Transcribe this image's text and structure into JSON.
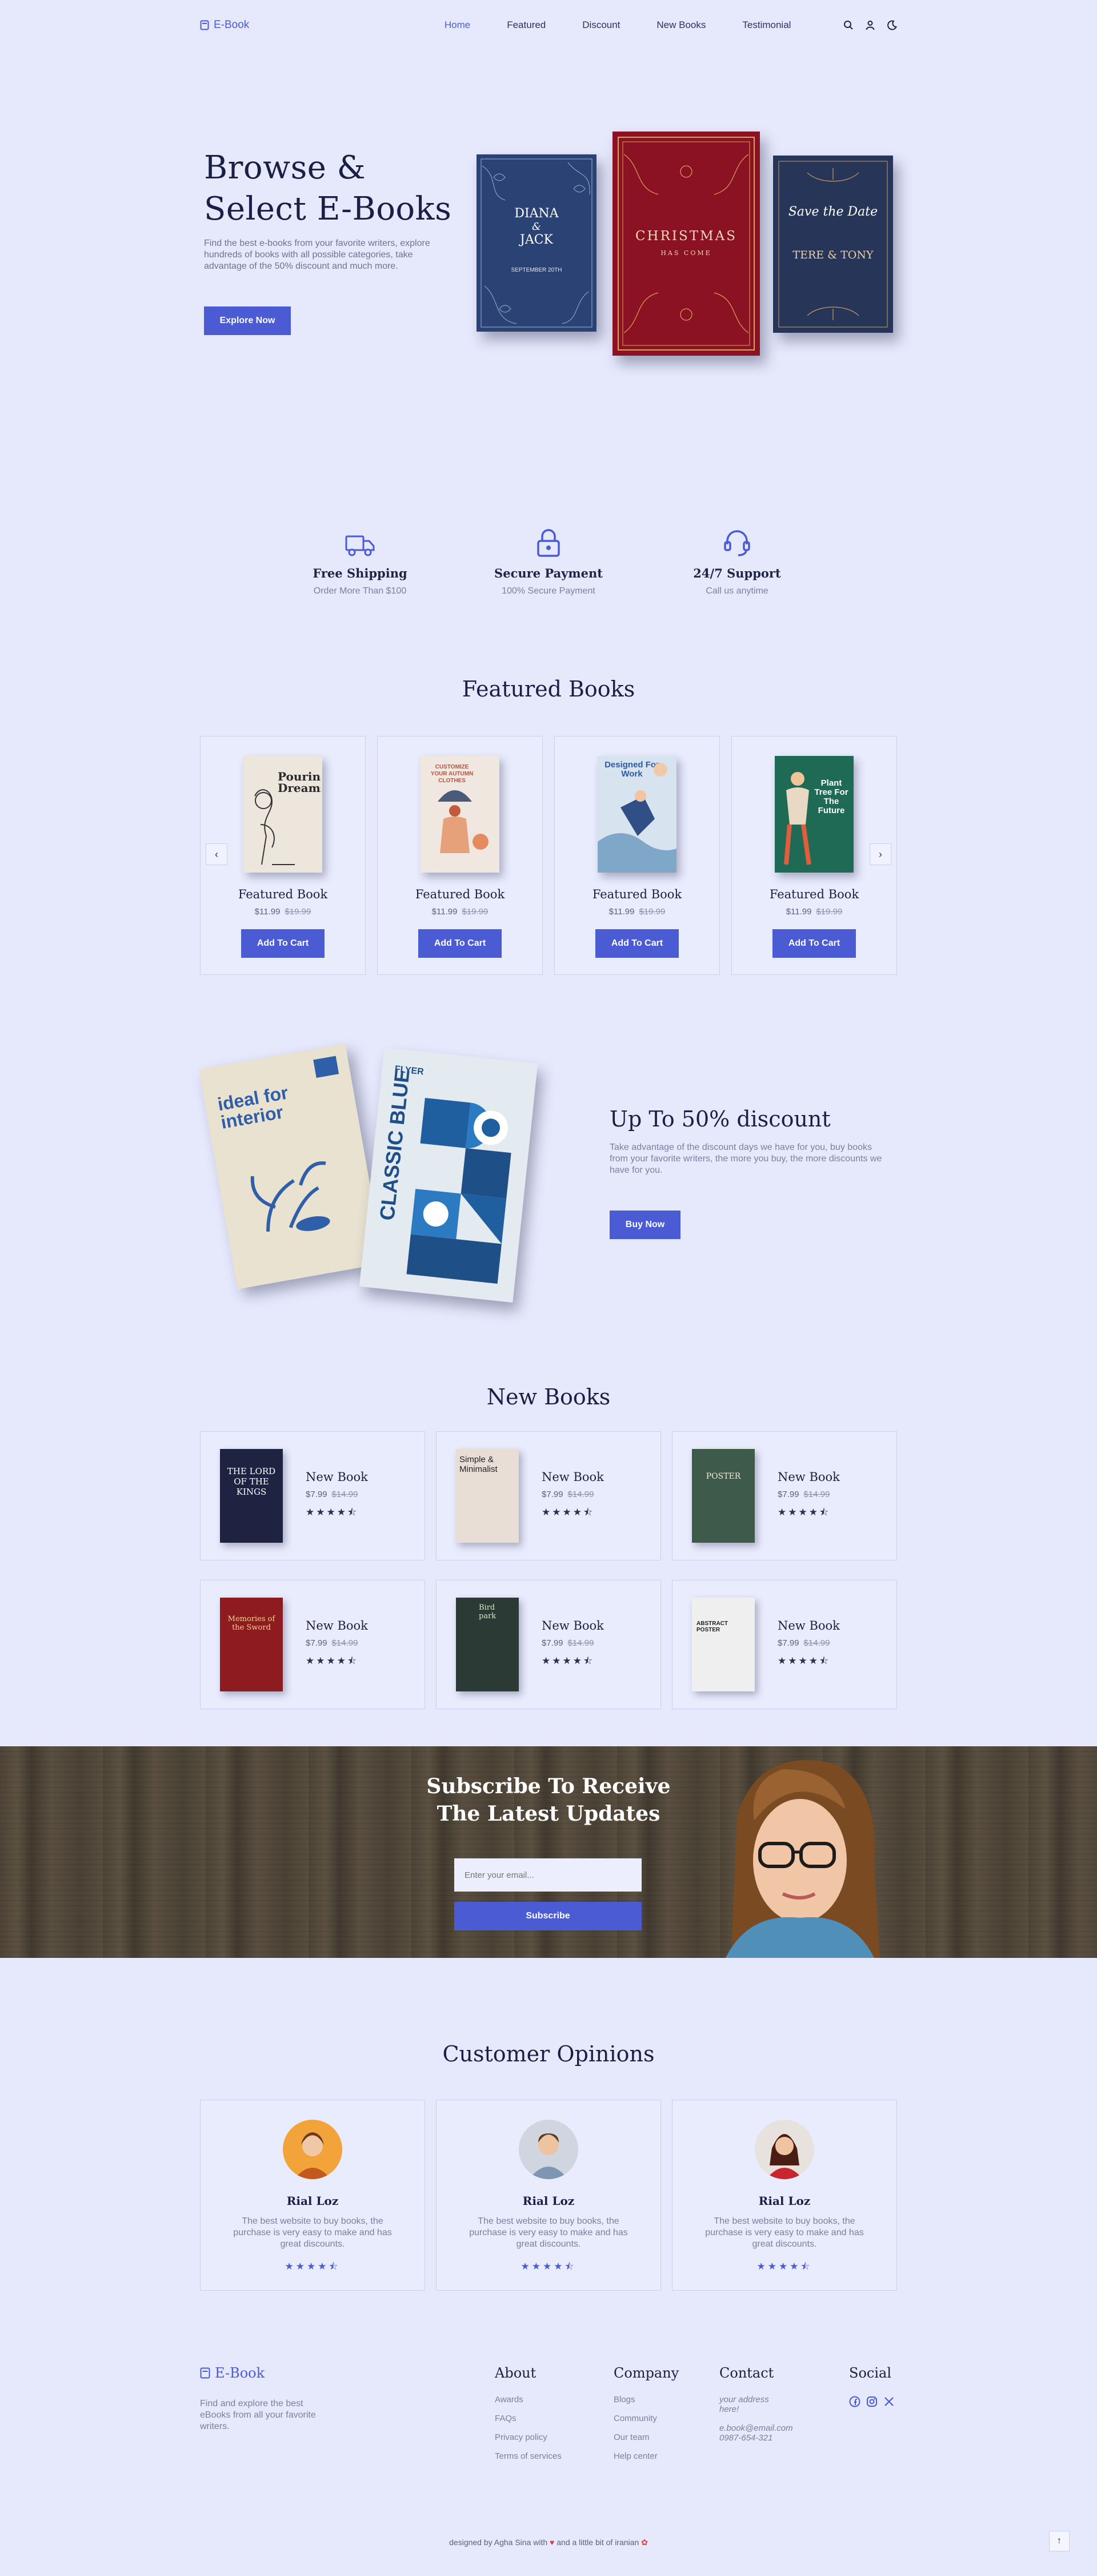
{
  "nav": {
    "logo": "E-Book",
    "links": [
      "Home",
      "Featured",
      "Discount",
      "New Books",
      "Testimonial"
    ],
    "icons": [
      "search-icon",
      "user-icon",
      "moon-icon"
    ]
  },
  "hero": {
    "title_line1": "Browse &",
    "title_line2": "Select E-Books",
    "subtitle": "Find the best e-books from your favorite writers, explore hundreds of books with all possible categories, take advantage of the 50% discount and much more.",
    "button": "Explore Now",
    "books": [
      {
        "title1": "DIANA",
        "amp": "&",
        "title2": "JACK",
        "date": "SEPTEMBER 20TH"
      },
      {
        "title1": "CHRISTMAS",
        "title2": "HAS COME"
      },
      {
        "title1": "Save the Date",
        "title2": "TERE & TONY"
      }
    ]
  },
  "features": [
    {
      "icon": "truck-icon",
      "title": "Free Shipping",
      "subtitle": "Order More Than $100"
    },
    {
      "icon": "lock-icon",
      "title": "Secure Payment",
      "subtitle": "100% Secure Payment"
    },
    {
      "icon": "headset-icon",
      "title": "24/7 Support",
      "subtitle": "Call us anytime"
    }
  ],
  "featured": {
    "heading": "Featured Books",
    "books": [
      {
        "title": "Featured Book",
        "price": "$11.99",
        "old_price": "$19.99",
        "button": "Add To Cart",
        "cover_text": "Pouring Dreams"
      },
      {
        "title": "Featured Book",
        "price": "$11.99",
        "old_price": "$19.99",
        "button": "Add To Cart",
        "cover_text": "CUSTOMIZE YOUR AUTUMN CLOTHES"
      },
      {
        "title": "Featured Book",
        "price": "$11.99",
        "old_price": "$19.99",
        "button": "Add To Cart",
        "cover_text": "Designed For Work"
      },
      {
        "title": "Featured Book",
        "price": "$11.99",
        "old_price": "$19.99",
        "button": "Add To Cart",
        "cover_text": "Plant Tree For The Future"
      }
    ],
    "prev": "‹",
    "next": "›"
  },
  "discount": {
    "title": "Up To 50% discount",
    "subtitle": "Take advantage of the discount days we have for you, buy books from your favorite writers, the more you buy, the more discounts we have for you.",
    "button": "Buy Now",
    "book1": {
      "label": "ideal for interior"
    },
    "book2": {
      "label": "CLASSIC BLUE",
      "top": "FLYER"
    }
  },
  "new_books": {
    "heading": "New Books",
    "books": [
      {
        "title": "New Book",
        "price": "$7.99",
        "old_price": "$14.99",
        "stars": "★★★★⯪",
        "cover_text": "THE LORD OF THE KINGS",
        "cover_color": "#1e2342"
      },
      {
        "title": "New Book",
        "price": "$7.99",
        "old_price": "$14.99",
        "stars": "★★★★⯪",
        "cover_text": "Simple & Minimalist",
        "cover_color": "#e8ded6"
      },
      {
        "title": "New Book",
        "price": "$7.99",
        "old_price": "$14.99",
        "stars": "★★★★⯪",
        "cover_text": "POSTER",
        "cover_color": "#3e5a4a"
      },
      {
        "title": "New Book",
        "price": "$7.99",
        "old_price": "$14.99",
        "stars": "★★★★⯪",
        "cover_text": "Memories of the Sword",
        "cover_color": "#8e1b1f"
      },
      {
        "title": "New Book",
        "price": "$7.99",
        "old_price": "$14.99",
        "stars": "★★★★⯪",
        "cover_text": "Bird park",
        "cover_color": "#2b3a35"
      },
      {
        "title": "New Book",
        "price": "$7.99",
        "old_price": "$14.99",
        "stars": "★★★★⯪",
        "cover_text": "ABSTRACT POSTER",
        "cover_color": "#efefef"
      }
    ]
  },
  "subscribe": {
    "title_line1": "Subscribe To Receive",
    "title_line2": "The Latest Updates",
    "placeholder": "Enter your email...",
    "button": "Subscribe"
  },
  "opinions": {
    "heading": "Customer Opinions",
    "items": [
      {
        "name": "Rial Loz",
        "text": "The best website to buy books, the purchase is very easy to make and has great discounts.",
        "stars": "★★★★⯪",
        "avatar_bg": "#f2a33a"
      },
      {
        "name": "Rial Loz",
        "text": "The best website to buy books, the purchase is very easy to make and has great discounts.",
        "stars": "★★★★⯪",
        "avatar_bg": "#cfd6e0"
      },
      {
        "name": "Rial Loz",
        "text": "The best website to buy books, the purchase is very easy to make and has great discounts.",
        "stars": "★★★★⯪",
        "avatar_bg": "#e7e2de"
      }
    ]
  },
  "footer": {
    "logo": "E-Book",
    "description": "Find and explore the best eBooks from all your favorite writers.",
    "about": {
      "heading": "About",
      "links": [
        "Awards",
        "FAQs",
        "Privacy policy",
        "Terms of services"
      ]
    },
    "company": {
      "heading": "Company",
      "links": [
        "Blogs",
        "Community",
        "Our team",
        "Help center"
      ]
    },
    "contact": {
      "heading": "Contact",
      "address_line1": "your address",
      "address_line2": "here!",
      "email": "e.book@email.com",
      "phone": "0987-654-321"
    },
    "social": {
      "heading": "Social",
      "icons": [
        "facebook-icon",
        "instagram-icon",
        "x-icon"
      ]
    },
    "credit_part1": "designed by Agha Sina with",
    "credit_part2": "and a little bit of iranian",
    "to_top": "↑"
  },
  "colors": {
    "accent": "#4a5bd4",
    "background": "#e6e9fc",
    "text": "#1a2045"
  }
}
